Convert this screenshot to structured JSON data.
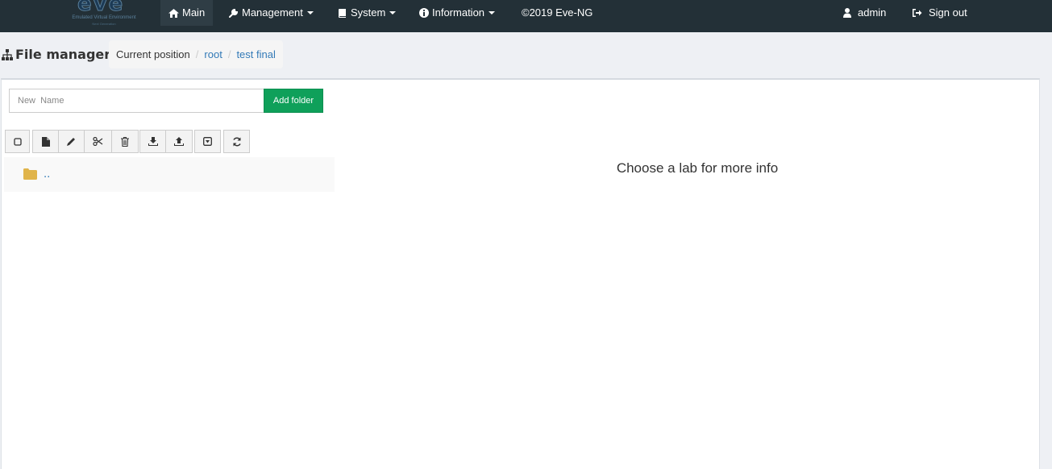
{
  "brand": {
    "logo_text": "eve",
    "tagline": "Emulated Virtual Environment",
    "sub_tagline": "Next Generation"
  },
  "nav": {
    "main": "Main",
    "management": "Management",
    "system": "System",
    "information": "Information",
    "copyright": "©2019 Eve-NG",
    "user": "admin",
    "signout": "Sign out"
  },
  "page": {
    "title": "File manager"
  },
  "breadcrumb": {
    "label": "Current position",
    "sep": "/",
    "items": [
      "root",
      "test final"
    ]
  },
  "folder_form": {
    "placeholder": "New  Name",
    "value": "",
    "button": "Add folder"
  },
  "toolbar": {
    "icons": [
      "checkbox-icon",
      "new-file-icon",
      "edit-icon",
      "cut-icon",
      "delete-icon",
      "import-icon",
      "export-icon",
      "download-icon",
      "refresh-icon"
    ]
  },
  "files": [
    {
      "name": "..",
      "type": "folder"
    }
  ],
  "info_panel": {
    "message": "Choose a lab for more info"
  },
  "colors": {
    "navbar": "#233037",
    "accent_green": "#0fa05a",
    "link": "#337ab7",
    "folder": "#e0b44a"
  }
}
